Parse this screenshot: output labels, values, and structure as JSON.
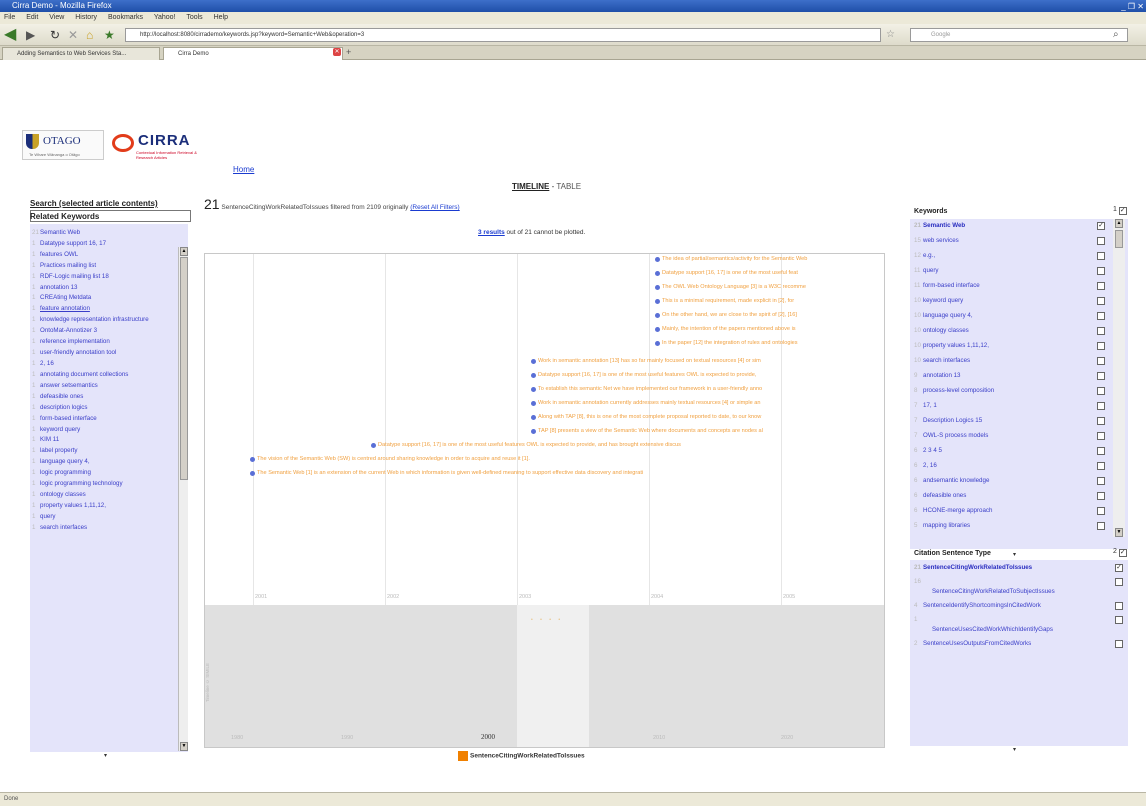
{
  "window": {
    "title": "Cirra Demo - Mozilla Firefox",
    "controls": "_ ❐ ✕"
  },
  "menu": [
    "File",
    "Edit",
    "View",
    "History",
    "Bookmarks",
    "Yahoo!",
    "Tools",
    "Help"
  ],
  "nav": {
    "url": "http://localhost:8080/cirrademo/keywords.jsp?keyword=Semantic+Web&operation=3",
    "search_placeholder": "Google"
  },
  "tabs": [
    {
      "label": "Adding Semantics to Web Services Sta..."
    },
    {
      "label": "Cirra Demo"
    }
  ],
  "status": "Done",
  "header": {
    "otago": "OTAGO",
    "otago_sub": "Te Whare Wānanga o Otāgo",
    "cirra": "CIRRA",
    "cirra_sub": "Contextual Information Retrieval & Research Articles",
    "home": "Home"
  },
  "left": {
    "search_title": "Search (selected article contents)",
    "related_title": "Related Keywords",
    "items": [
      {
        "count": "21",
        "label": "Semantic Web"
      },
      {
        "count": "1",
        "label": "Datatype support 16, 17"
      },
      {
        "count": "1",
        "label": "features OWL"
      },
      {
        "count": "1",
        "label": "Practices mailing list"
      },
      {
        "count": "1",
        "label": "RDF-Logic mailing list 18"
      },
      {
        "count": "1",
        "label": "annotation 13"
      },
      {
        "count": "1",
        "label": "CREAting Metdata"
      },
      {
        "count": "1",
        "label": "feature annotation"
      },
      {
        "count": "1",
        "label": "knowledge representation infrastructure"
      },
      {
        "count": "1",
        "label": "OntoMat-Annotizer 3"
      },
      {
        "count": "1",
        "label": "reference implementation"
      },
      {
        "count": "1",
        "label": "user-friendly annotation tool"
      },
      {
        "count": "1",
        "label": "2, 16"
      },
      {
        "count": "1",
        "label": "annotating document collections"
      },
      {
        "count": "1",
        "label": "answer setsemantics"
      },
      {
        "count": "1",
        "label": "defeasible ones"
      },
      {
        "count": "1",
        "label": "description logics"
      },
      {
        "count": "1",
        "label": "form-based interface"
      },
      {
        "count": "1",
        "label": "keyword query"
      },
      {
        "count": "1",
        "label": "KIM 11"
      },
      {
        "count": "1",
        "label": "label property"
      },
      {
        "count": "1",
        "label": "language query 4,"
      },
      {
        "count": "1",
        "label": "logic programming"
      },
      {
        "count": "1",
        "label": "logic programming technology"
      },
      {
        "count": "1",
        "label": "ontology classes"
      },
      {
        "count": "1",
        "label": "property values 1,11,12,"
      },
      {
        "count": "1",
        "label": "query"
      },
      {
        "count": "1",
        "label": "search interfaces"
      }
    ]
  },
  "center": {
    "tab_timeline": "TIMELINE",
    "tab_sep": " - ",
    "tab_table": "TABLE",
    "count": "21",
    "summary_text": " SentenceCitingWorkRelatedToIssues filtered from 2109 originally ",
    "reset": "(Reset All Filters)",
    "unplot_link": "3 results",
    "unplot_text": " out of 21 cannot be plotted.",
    "years": [
      "2001",
      "2002",
      "2003",
      "2004",
      "2005"
    ],
    "overview_years": [
      "1980",
      "1990",
      "2000",
      "2010",
      "2020"
    ],
    "overview_side": "Timeline © SIMILE",
    "events": [
      "The idea of partial/semantics/activity for the Semantic Web",
      "Datatype support [16, 17] is one of the most useful feat",
      "The OWL Web Ontology Language [3] is a W3C recomme",
      "This is a minimal requirement, made explicit in [2], for",
      "On the other hand, we are close to the spirit of [2], [16]",
      "Mainly, the intention of the papers mentioned above is",
      "In the paper [12] the integration of rules and ontologies",
      "Work in semantic annotation [13] has so far mainly focused on textual resources [4] or sim",
      "Datatype support [16, 17] is one of the most useful features OWL is expected to provide,",
      "To establish this semantic Net we have implemented our framework in a user-friendly anno",
      "Work in semantic annotation currently addresses mainly textual resources [4] or simple an",
      "Along with TAP [8], this is one of the most complete proposal reported to date, to our know",
      "TAP [8] presents a view of the Semantic Web where documents and concepts are nodes al",
      "Datatype support [16, 17] is one of the most useful features OWL is expected to provide, and has brought extensive discus",
      "The vision of the Semantic Web (SW) is centred around sharing knowledge in order to acquire and reuse it [1].",
      "The Semantic Web [1] is an extension of the current Web in which information is given well-defined meaning to support effective data discovery and integrati"
    ],
    "legend": "SentenceCitingWorkRelatedToIssues",
    "legend_color": "#f08000"
  },
  "right": {
    "keywords_title": "Keywords",
    "keywords_count": "1",
    "keywords": [
      {
        "count": "21",
        "label": "Semantic Web",
        "checked": true
      },
      {
        "count": "15",
        "label": "web services"
      },
      {
        "count": "12",
        "label": "e.g.,"
      },
      {
        "count": "11",
        "label": "query"
      },
      {
        "count": "11",
        "label": "form-based interface"
      },
      {
        "count": "10",
        "label": "keyword query"
      },
      {
        "count": "10",
        "label": "language query 4,"
      },
      {
        "count": "10",
        "label": "ontology classes"
      },
      {
        "count": "10",
        "label": "property values 1,11,12,"
      },
      {
        "count": "10",
        "label": "search interfaces"
      },
      {
        "count": "9",
        "label": "annotation 13"
      },
      {
        "count": "8",
        "label": "process-level composition"
      },
      {
        "count": "7",
        "label": "17, 1"
      },
      {
        "count": "7",
        "label": "Description Logics 15"
      },
      {
        "count": "7",
        "label": "OWL-S process models"
      },
      {
        "count": "6",
        "label": "2 3 4 5"
      },
      {
        "count": "6",
        "label": "2, 16"
      },
      {
        "count": "6",
        "label": "andsemantic knowledge"
      },
      {
        "count": "6",
        "label": "defeasible ones"
      },
      {
        "count": "6",
        "label": "HCONE-merge approach"
      },
      {
        "count": "5",
        "label": "mapping libraries"
      }
    ],
    "cst_title": "Citation Sentence Type",
    "cst_count": "2",
    "cst": [
      {
        "count": "21",
        "label": "SentenceCitingWorkRelatedToIssues",
        "checked": true
      },
      {
        "count": "16",
        "label": "SentenceCitingWorkRelatedToSubjectIssues"
      },
      {
        "count": "4",
        "label": "SentenceIdentifyShortcomingsInCitedWork"
      },
      {
        "count": "1",
        "label": "SentenceUsesCitedWorkWhichIdentifyGaps"
      },
      {
        "count": "2",
        "label": "SentenceUsesOutputsFromCitedWorks"
      }
    ]
  }
}
